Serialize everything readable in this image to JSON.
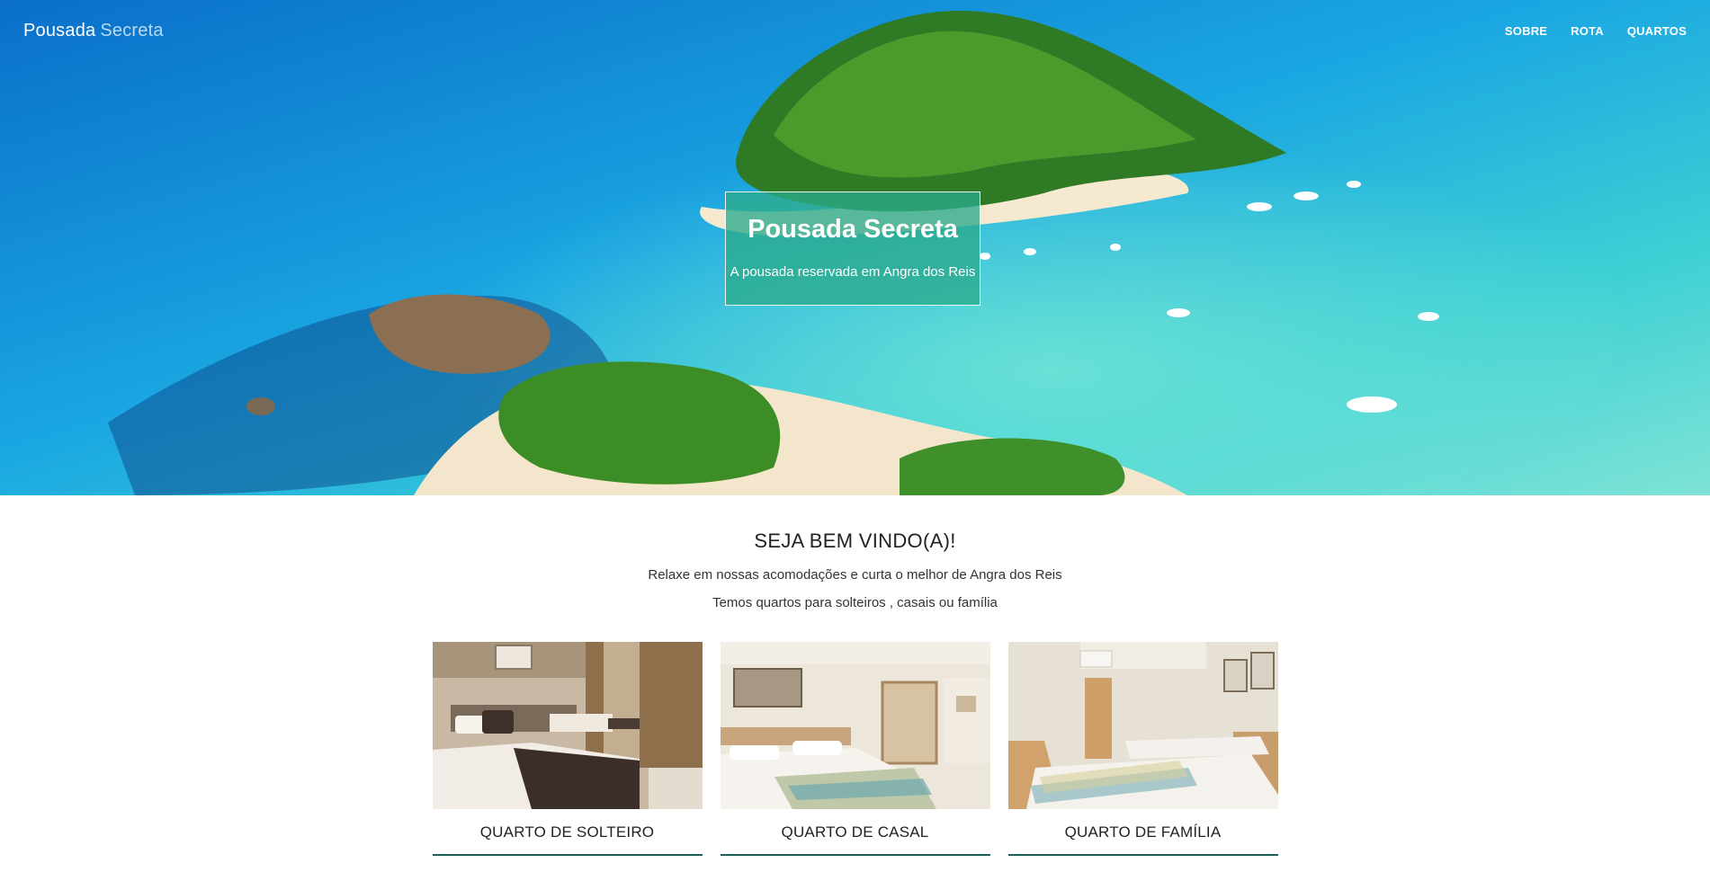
{
  "navbar": {
    "brand_primary": "Pousada",
    "brand_secondary": "Secreta",
    "links": [
      {
        "label": "SOBRE"
      },
      {
        "label": "ROTA"
      },
      {
        "label": "QUARTOS"
      }
    ]
  },
  "hero": {
    "title": "Pousada Secreta",
    "subtitle": "A pousada reservada em Angra dos Reis"
  },
  "welcome": {
    "title": "SEJA BEM VINDO(A)!",
    "line1": "Relaxe em nossas acomodações e curta o melhor de Angra dos Reis",
    "line2": "Temos quartos para solteiros , casais ou família"
  },
  "rooms": [
    {
      "label": "QUARTO DE SOLTEIRO"
    },
    {
      "label": "QUARTO DE CASAL"
    },
    {
      "label": "QUARTO DE FAMÍLIA"
    }
  ],
  "colors": {
    "hero_box": "#2caa8c",
    "accent_line": "#1d5e54"
  }
}
